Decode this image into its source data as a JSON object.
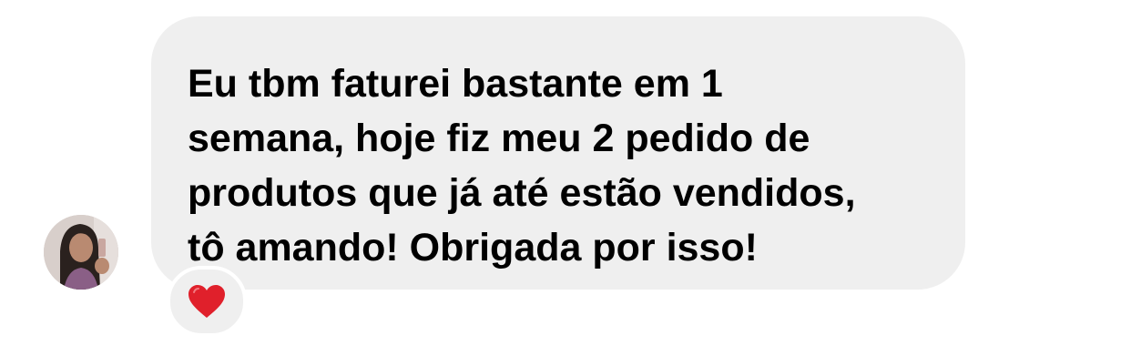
{
  "message": {
    "lines": [
      "Eu tbm faturei bastante em 1",
      "semana, hoje fiz meu 2 pedido de",
      "produtos que já até estão vendidos,",
      "tô amando! Obrigada por isso!"
    ],
    "bubble_color": "#efefef",
    "text_color": "#000000"
  },
  "sender": {
    "avatar_icon": "profile-photo"
  },
  "reaction": {
    "icon": "red-heart-icon",
    "color": "#e0202b"
  }
}
